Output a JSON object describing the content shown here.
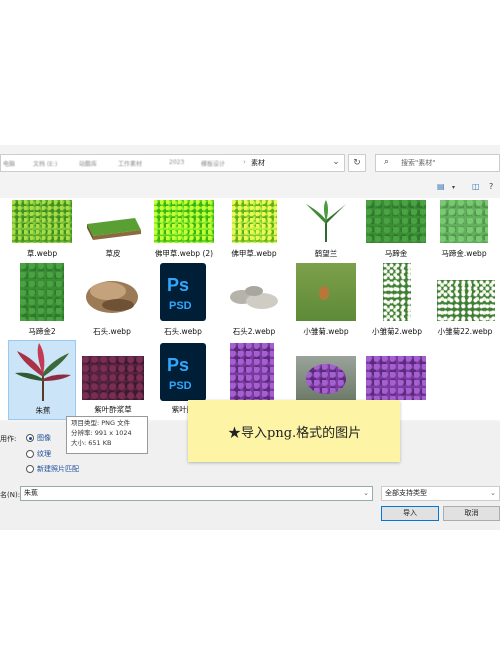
{
  "address_bar": {
    "crumbs": [
      "电脑",
      "文档 (E:)",
      "站酷库",
      "工作素材",
      "2023",
      "模板设计"
    ],
    "current": "素材",
    "refresh_icon": "refresh-icon",
    "chevron_icon": "chevron-down-icon"
  },
  "search": {
    "placeholder": "搜索\"素材\""
  },
  "files": [
    {
      "name": "草.webp",
      "kind": "grass"
    },
    {
      "name": "草皮",
      "kind": "turf"
    },
    {
      "name": "佛甲草.webp (2)",
      "kind": "grass-light"
    },
    {
      "name": "佛甲草.webp",
      "kind": "grass-light"
    },
    {
      "name": "鹤望兰",
      "kind": "plant-cutout"
    },
    {
      "name": "马蹄金",
      "kind": "clover"
    },
    {
      "name": "马蹄金.webp",
      "kind": "clover-light"
    },
    {
      "name": "马蹄金2",
      "kind": "clover"
    },
    {
      "name": "石头.webp",
      "kind": "stone"
    },
    {
      "name": "石头.webp",
      "kind": "psd"
    },
    {
      "name": "石头2.webp",
      "kind": "stones"
    },
    {
      "name": "小雏菊.webp",
      "kind": "field"
    },
    {
      "name": "小雏菊2.webp",
      "kind": "whiteflower"
    },
    {
      "name": "小雏菊22.webp",
      "kind": "whiteflower"
    },
    {
      "name": "朱蕉",
      "kind": "plant-selected"
    },
    {
      "name": "紫叶酢浆草",
      "kind": "darkleaf"
    },
    {
      "name": "紫叶酢",
      "kind": "psd"
    },
    {
      "name": "",
      "kind": "purple"
    },
    {
      "name": "",
      "kind": "purple"
    },
    {
      "name": "",
      "kind": "purple"
    }
  ],
  "tooltip": {
    "type": "项目类型: PNG 文件",
    "resolution": "分辨率: 991 x 1024",
    "size": "大小: 651 KB"
  },
  "options": {
    "label": "用作:",
    "items": [
      "图像",
      "纹理",
      "新建照片匹配"
    ],
    "selected": 0
  },
  "filename": {
    "label": "名(N):",
    "value": "朱蕉"
  },
  "filetype": {
    "value": "全部支持类型"
  },
  "buttons": {
    "import": "导入",
    "cancel": "取消"
  },
  "sticky_note": {
    "star": "★",
    "text": "导入png.格式的图片"
  },
  "colors": {
    "accent": "#0078d7",
    "selection": "#cce4f7",
    "sticky": "#fdf4a6"
  }
}
